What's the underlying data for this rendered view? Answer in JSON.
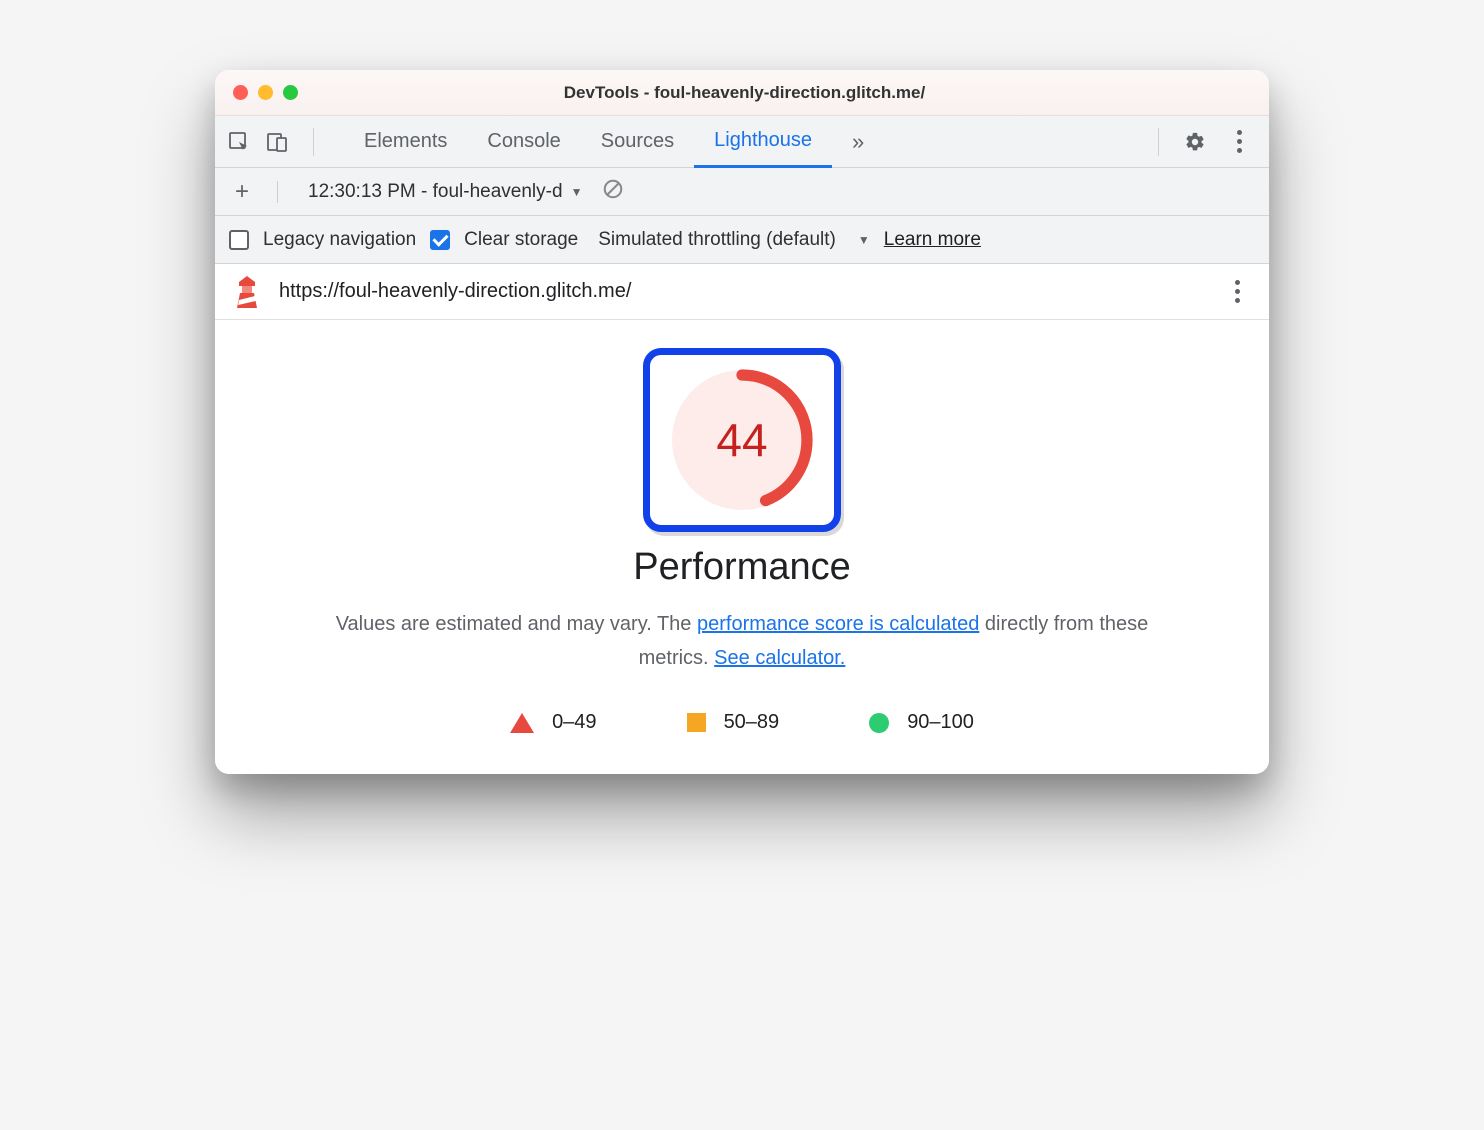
{
  "window": {
    "title": "DevTools - foul-heavenly-direction.glitch.me/"
  },
  "tabs": {
    "elements": "Elements",
    "console": "Console",
    "sources": "Sources",
    "lighthouse": "Lighthouse"
  },
  "toolbar": {
    "run_label": "12:30:13 PM - foul-heavenly-d"
  },
  "options": {
    "legacy_navigation": "Legacy navigation",
    "clear_storage": "Clear storage",
    "throttling": "Simulated throttling (default)",
    "learn_more": "Learn more"
  },
  "url": "https://foul-heavenly-direction.glitch.me/",
  "report": {
    "score": "44",
    "score_value": 44,
    "title": "Performance",
    "desc_prefix": "Values are estimated and may vary. The ",
    "link_calc": "performance score is calculated",
    "desc_mid": " directly from these metrics. ",
    "link_see": "See calculator."
  },
  "legend": {
    "poor": "0–49",
    "avg": "50–89",
    "good": "90–100"
  },
  "colors": {
    "accent": "#1a73e8",
    "fail": "#c5221f",
    "highlight_border": "#1141e8"
  }
}
